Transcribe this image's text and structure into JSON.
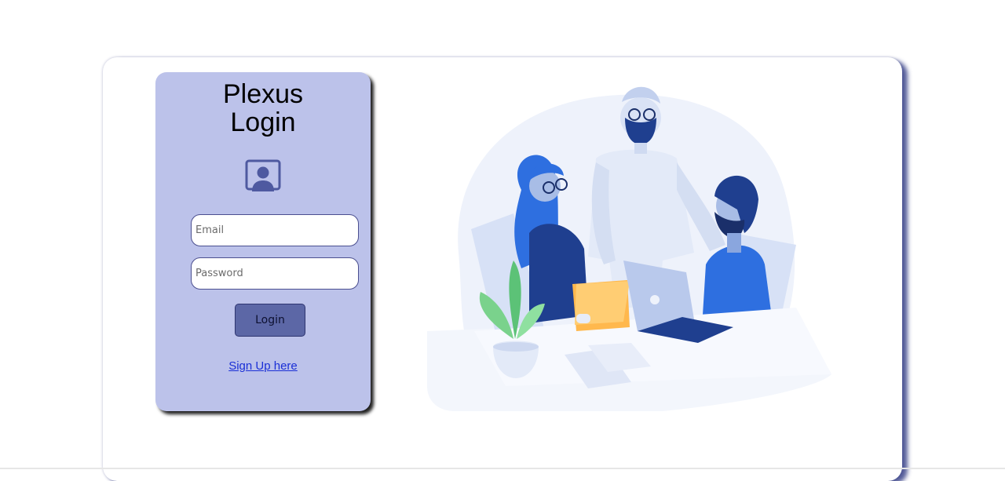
{
  "login": {
    "title_line1": "Plexus",
    "title_line2": "Login",
    "email_placeholder": "Email",
    "password_placeholder": "Password",
    "login_label": "Login",
    "signup_label": "Sign Up here"
  },
  "icons": {
    "profile": "user-profile-icon"
  },
  "colors": {
    "panel_background": "#bcc2ea",
    "button_background": "#5c67a6",
    "link": "#1a2fd6",
    "illustration_primary": "#2e6fe0"
  }
}
